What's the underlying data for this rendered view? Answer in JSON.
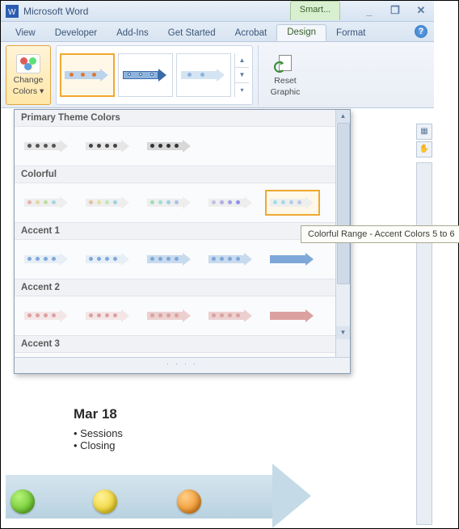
{
  "titlebar": {
    "app": "Microsoft Word",
    "context_tab": "Smart..."
  },
  "sysbuttons": {
    "min": "_",
    "restore": "❐",
    "close": "✕"
  },
  "tabs": {
    "items": [
      "View",
      "Developer",
      "Add-Ins",
      "Get Started",
      "Acrobat",
      "Design",
      "Format"
    ],
    "active": "Design",
    "help": "?"
  },
  "ribbon": {
    "change_colors": {
      "label_l1": "Change",
      "label_l2": "Colors ▾"
    },
    "reset": {
      "label_l1": "Reset",
      "label_l2": "Graphic"
    },
    "gallery_more": {
      "up": "▲",
      "down": "▼",
      "expand": "▾"
    }
  },
  "color_gallery": {
    "sections": {
      "primary": "Primary Theme Colors",
      "colorful": "Colorful",
      "accent1": "Accent 1",
      "accent2": "Accent 2",
      "accent3": "Accent 3"
    },
    "scroll": {
      "up": "▲",
      "down": "▼"
    },
    "strip": ". . . ."
  },
  "tooltip": "Colorful Range - Accent Colors 5 to 6",
  "document": {
    "date": "Mar 18",
    "bullets": [
      "Sessions",
      "Closing"
    ]
  },
  "thumb_colors": {
    "primary": [
      "#6f6f6f"
    ],
    "colorful_row": [
      "#d97a7a",
      "#e0b060",
      "#9fcf6a",
      "#6fb8cf",
      "#6f8fd9"
    ],
    "colorful_items": [
      [
        "#e6b3b3",
        "#e6d6a0",
        "#bfe0a0",
        "#a0d8e0",
        "#a8b8e6"
      ],
      [
        "#e6c0a0",
        "#e6e0a0",
        "#bfe6c0",
        "#a0d0e6",
        "#c0b0e6"
      ],
      [
        "#a0e0b0",
        "#a0e0d0",
        "#a0d0e6",
        "#b0c0e6",
        "#d0b0e6"
      ],
      [
        "#c0c0e6",
        "#b0b0e6",
        "#a0a0e6",
        "#9090e6",
        "#8080e0"
      ],
      [
        "#a0e0e6",
        "#a8d8e6",
        "#b0d0e6",
        "#b8c8e6",
        "#c0c0e6"
      ]
    ],
    "accent1_base": "#7fa8d8",
    "accent2_base": "#dba0a0"
  }
}
